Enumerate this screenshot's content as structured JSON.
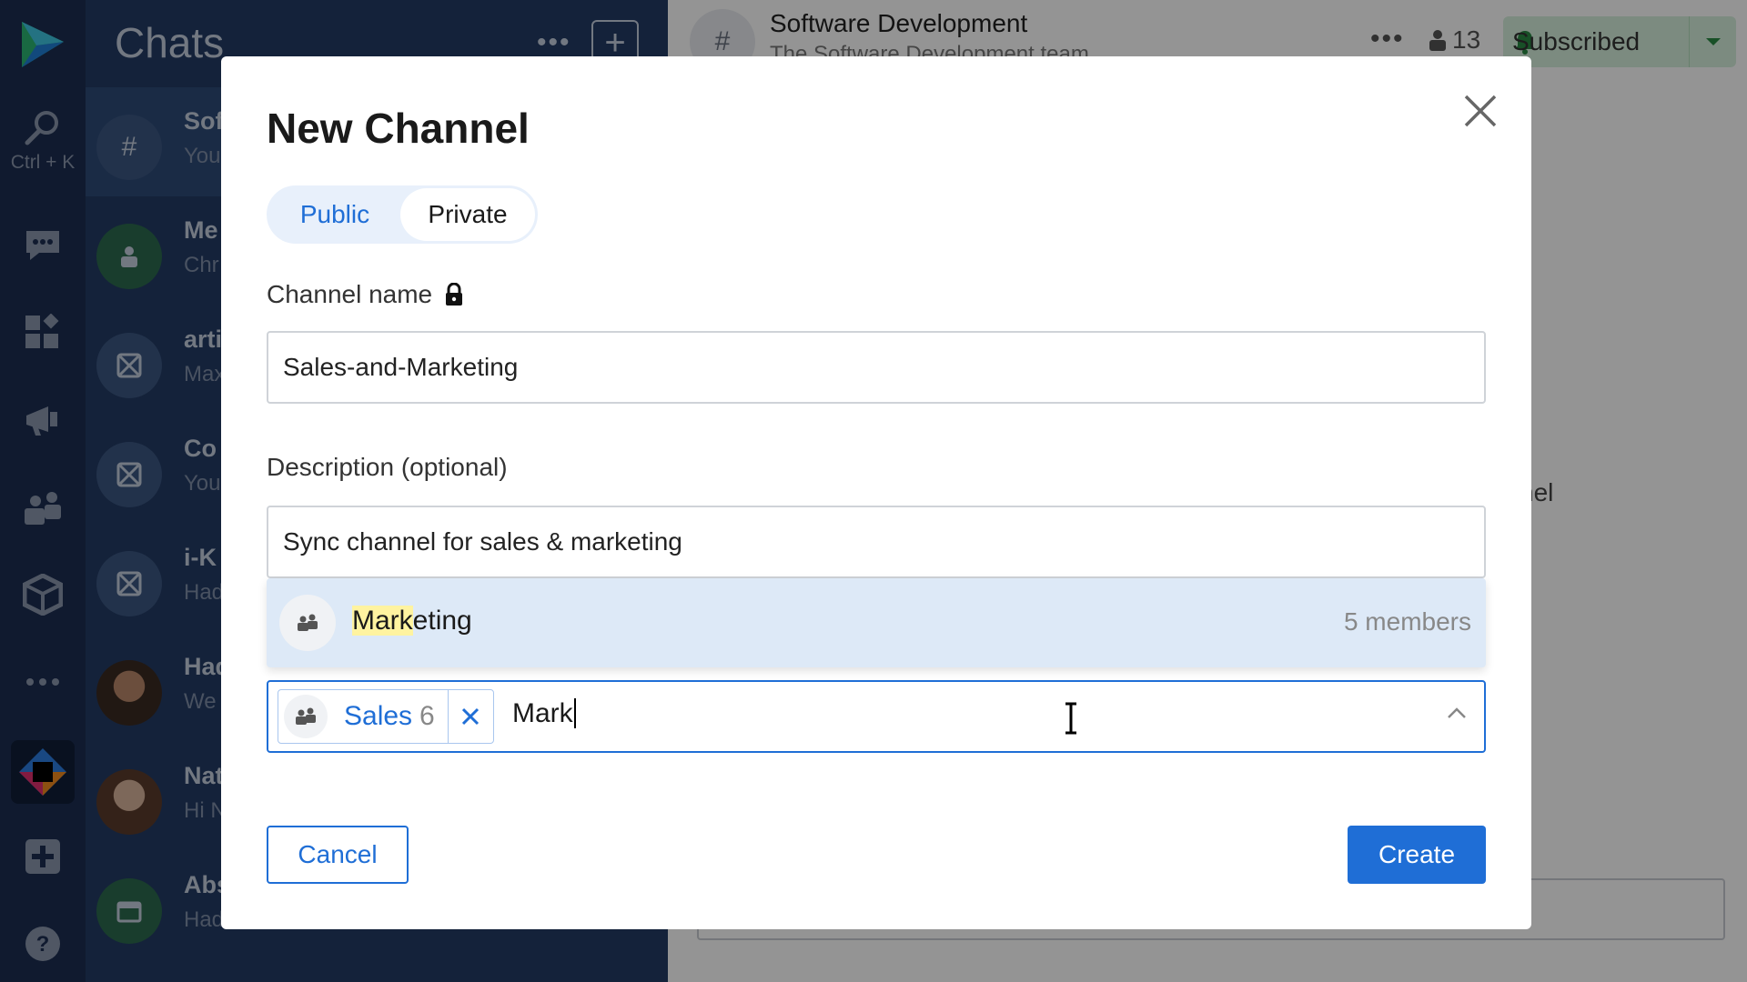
{
  "sidebar": {
    "search_shortcut": "Ctrl + K",
    "icons": [
      "logo-icon",
      "search-icon",
      "chat-icon",
      "apps-icon",
      "megaphone-icon",
      "team-icon",
      "package-icon",
      "more-icon",
      "space-icon",
      "add-icon",
      "help-icon"
    ]
  },
  "chatlist": {
    "title": "Chats",
    "more": "•••",
    "new_button": "+",
    "items": [
      {
        "name": "Sof",
        "preview": "You",
        "avatar": "#"
      },
      {
        "name": "Me",
        "preview": "Chr",
        "avatar": "person"
      },
      {
        "name": "arti",
        "preview": "Max",
        "avatar": "x"
      },
      {
        "name": "Co",
        "preview": "You",
        "avatar": "x"
      },
      {
        "name": "i-K",
        "preview": "Had",
        "avatar": "x"
      },
      {
        "name": "Had",
        "preview": "We",
        "avatar": "photo"
      },
      {
        "name": "Nat",
        "preview": "Hi N",
        "avatar": "photo"
      },
      {
        "name": "Abs",
        "preview": "Had",
        "avatar": "calendar"
      }
    ]
  },
  "main": {
    "channel_avatar": "#",
    "channel_title": "Software Development",
    "channel_subtitle": "The Software Development team",
    "more": "•••",
    "member_count": "13",
    "subscribed_label": "Subscribed",
    "background_text": "nel"
  },
  "modal": {
    "title": "New Channel",
    "visibility": {
      "public": "Public",
      "private": "Private",
      "selected": "Public"
    },
    "channel_name_label": "Channel name",
    "channel_name_value": "Sales-and-Marketing",
    "description_label": "Description (optional)",
    "description_value": "Sync channel for sales & marketing",
    "dropdown": {
      "match": "Mark",
      "rest": "eting",
      "members": "5 members"
    },
    "selected_chip": {
      "name": "Sales",
      "count": "6"
    },
    "search_text": "Mark",
    "cancel_label": "Cancel",
    "create_label": "Create"
  },
  "colors": {
    "accent": "#1f6ed6",
    "rail": "#1c2e52",
    "chatlist": "#233b64",
    "subscribed": "#2a8a44",
    "highlight": "#fff3a0"
  }
}
